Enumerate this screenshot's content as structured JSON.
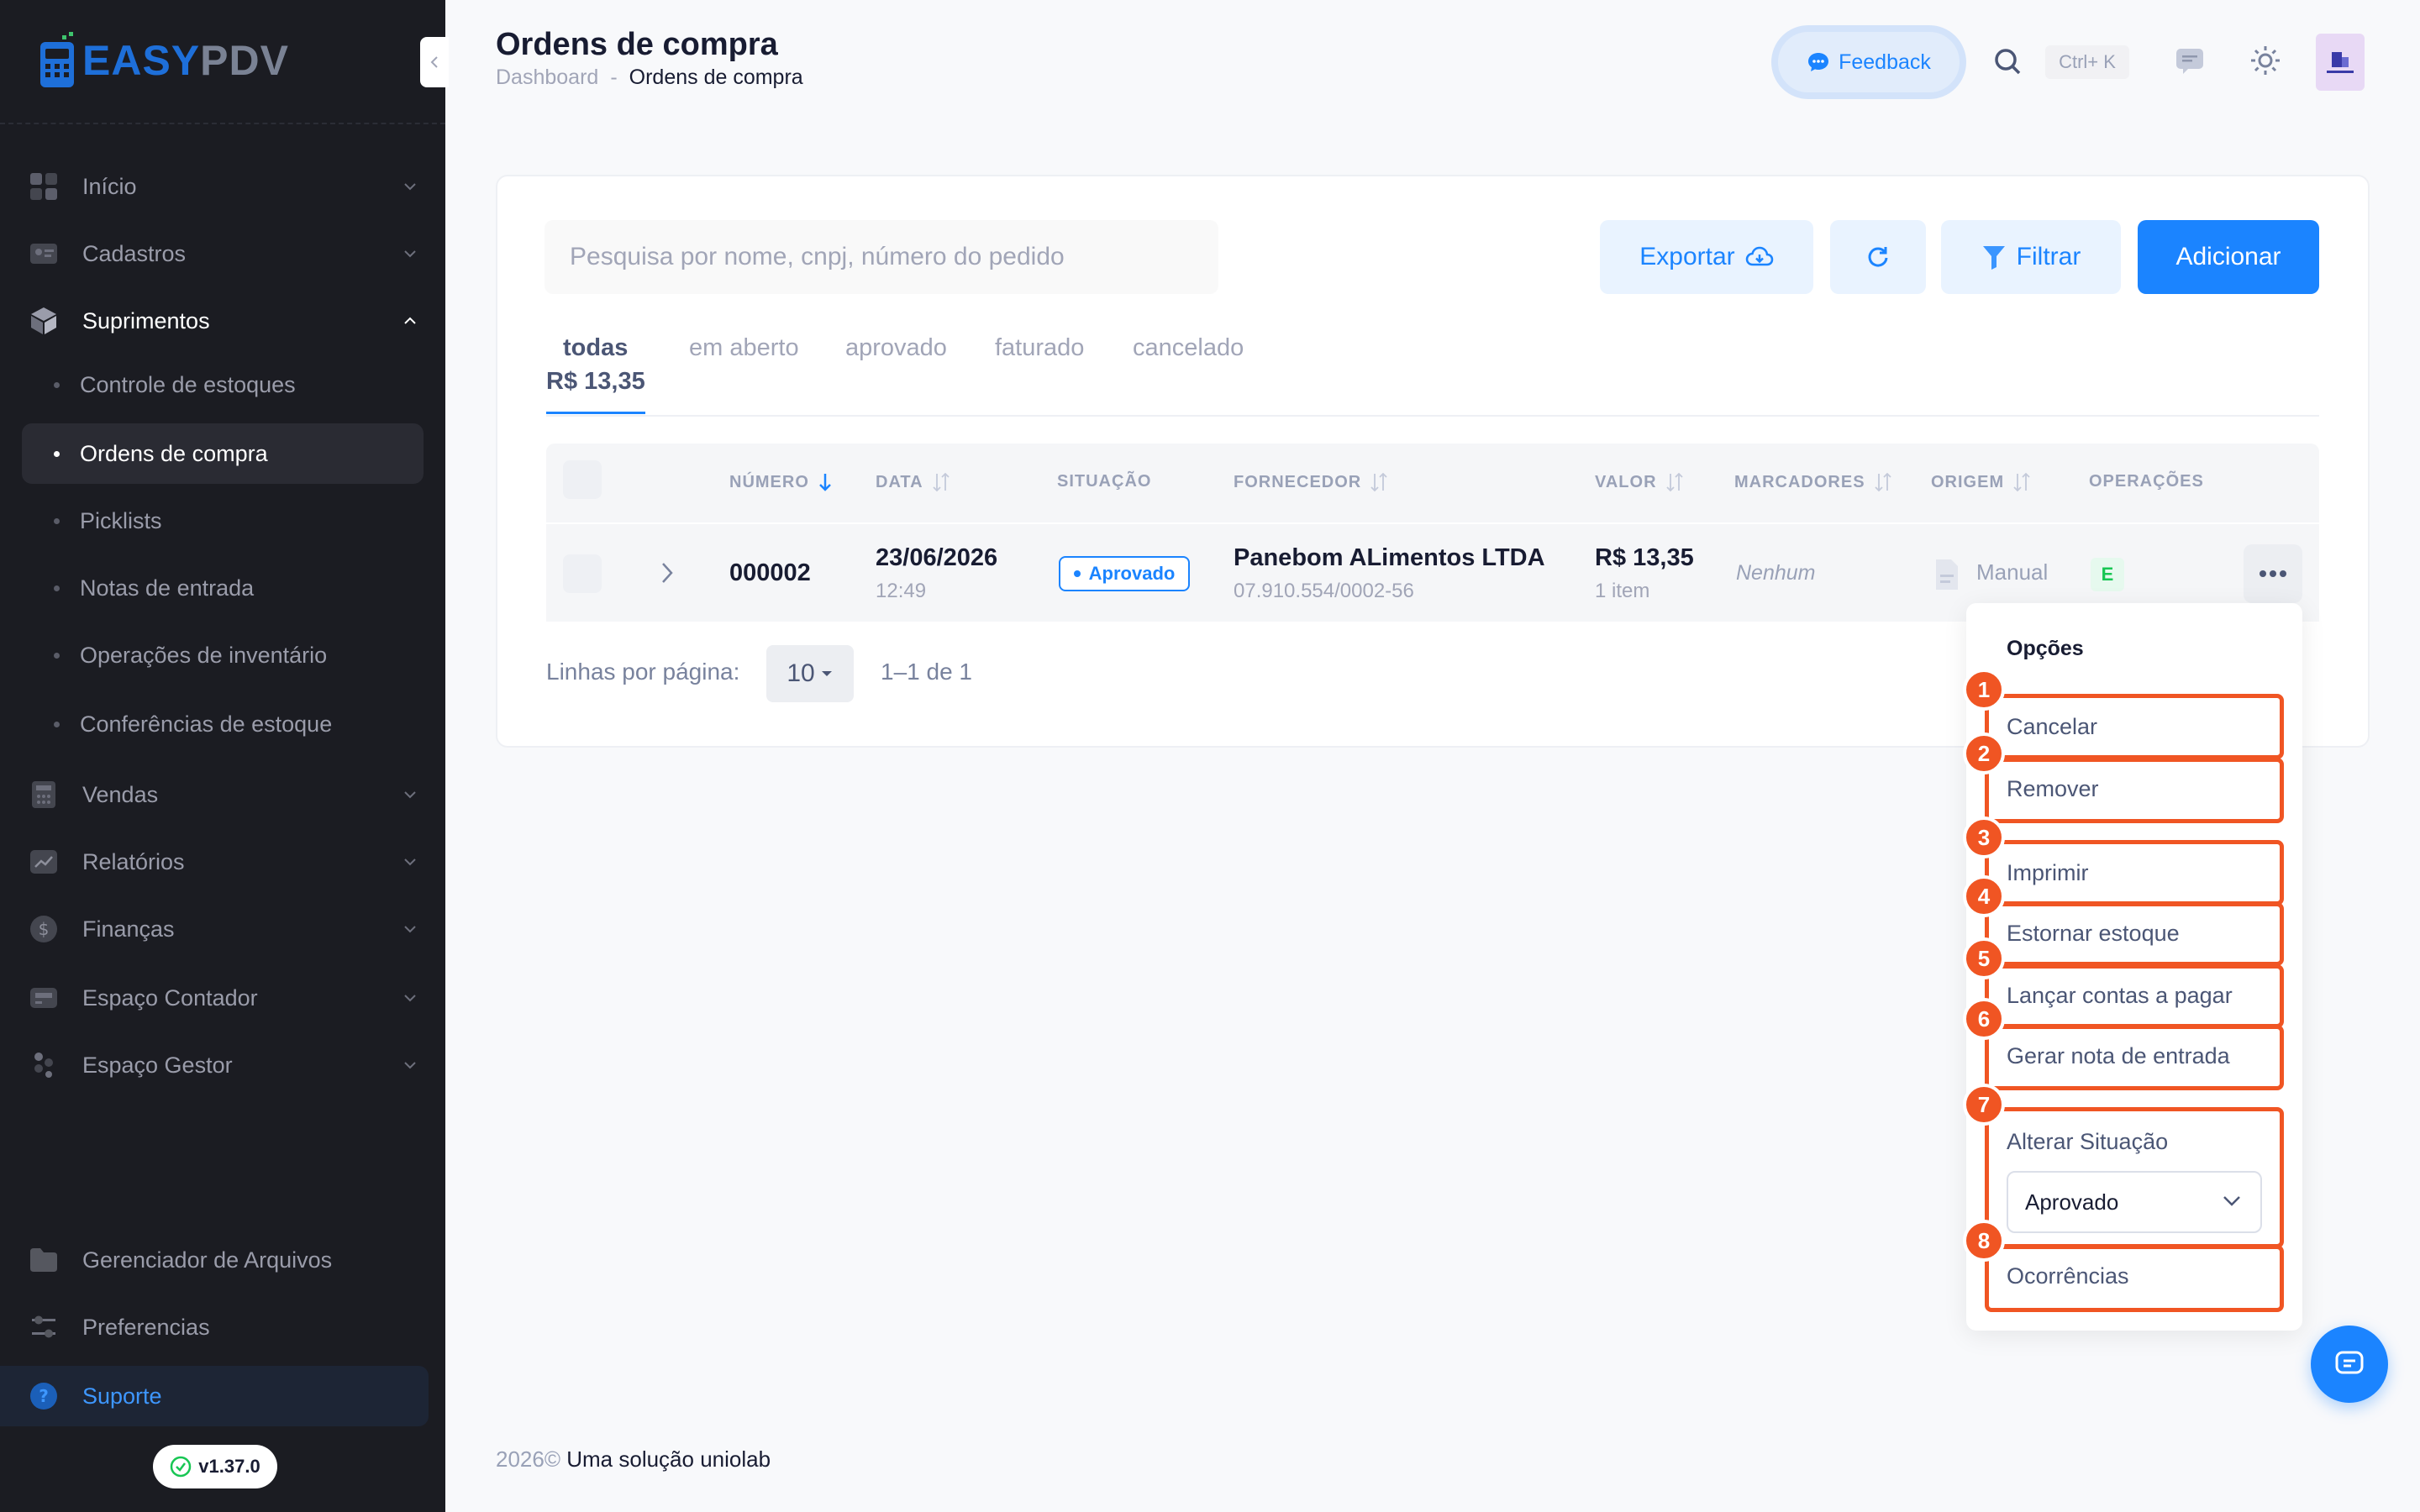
{
  "brand": {
    "part1": "EASY",
    "part2": "PDV"
  },
  "sidebar": {
    "items": [
      {
        "label": "Início",
        "icon": "home-icon"
      },
      {
        "label": "Cadastros",
        "icon": "id-card-icon"
      },
      {
        "label": "Suprimentos",
        "icon": "box-icon"
      },
      {
        "label": "Vendas",
        "icon": "calculator-icon"
      },
      {
        "label": "Relatórios",
        "icon": "chart-icon"
      },
      {
        "label": "Finanças",
        "icon": "dollar-icon"
      },
      {
        "label": "Espaço Contador",
        "icon": "printer-icon"
      },
      {
        "label": "Espaço Gestor",
        "icon": "users-icon"
      }
    ],
    "sub_items": [
      {
        "label": "Controle de estoques"
      },
      {
        "label": "Ordens de compra"
      },
      {
        "label": "Picklists"
      },
      {
        "label": "Notas de entrada"
      },
      {
        "label": "Operações de inventário"
      },
      {
        "label": "Conferências de estoque"
      }
    ],
    "bottom": [
      {
        "label": "Gerenciador de Arquivos",
        "icon": "folder-icon"
      },
      {
        "label": "Preferencias",
        "icon": "sliders-icon"
      }
    ],
    "support_label": "Suporte",
    "version": "v1.37.0"
  },
  "header": {
    "title": "Ordens de compra",
    "breadcrumb": [
      "Dashboard",
      "-",
      "Ordens de compra"
    ],
    "feedback_label": "Feedback",
    "shortcut": "Ctrl+ K"
  },
  "toolbar": {
    "search_placeholder": "Pesquisa por nome, cnpj, número do pedido",
    "export_label": "Exportar",
    "filter_label": "Filtrar",
    "add_label": "Adicionar"
  },
  "tabs": [
    {
      "label": "todas",
      "amount": "R$ 13,35",
      "active": true
    },
    {
      "label": "em aberto"
    },
    {
      "label": "aprovado"
    },
    {
      "label": "faturado"
    },
    {
      "label": "cancelado"
    }
  ],
  "table": {
    "columns": [
      "NÚMERO",
      "DATA",
      "SITUAÇÃO",
      "FORNECEDOR",
      "VALOR",
      "MARCADORES",
      "ORIGEM",
      "OPERAÇÕES"
    ],
    "rows": [
      {
        "numero": "000002",
        "data": "23/06/2026",
        "hora": "12:49",
        "situacao": "Aprovado",
        "fornecedor": "Panebom ALimentos LTDA",
        "cnpj": "07.910.554/0002-56",
        "valor": "R$ 13,35",
        "itens": "1 item",
        "marcadores": "Nenhum",
        "origem": "Manual",
        "operacao": "E"
      }
    ]
  },
  "pagination": {
    "rows_label": "Linhas por página:",
    "rows_value": "10",
    "range": "1–1 de 1"
  },
  "dropdown": {
    "title": "Opções",
    "items": [
      {
        "n": "1",
        "label": "Cancelar"
      },
      {
        "n": "2",
        "label": "Remover"
      },
      {
        "n": "3",
        "label": "Imprimir"
      },
      {
        "n": "4",
        "label": "Estornar estoque"
      },
      {
        "n": "5",
        "label": "Lançar contas a pagar"
      },
      {
        "n": "6",
        "label": "Gerar nota de entrada"
      },
      {
        "n": "7",
        "label": "Alterar Situação"
      },
      {
        "n": "8",
        "label": "Ocorrências"
      }
    ],
    "status_value": "Aprovado"
  },
  "footer": {
    "year": "2026©",
    "text": "Uma solução uniolab"
  },
  "colors": {
    "primary": "#1b84ff",
    "highlight": "#f05523",
    "sidebar_bg": "#1b1c22"
  }
}
